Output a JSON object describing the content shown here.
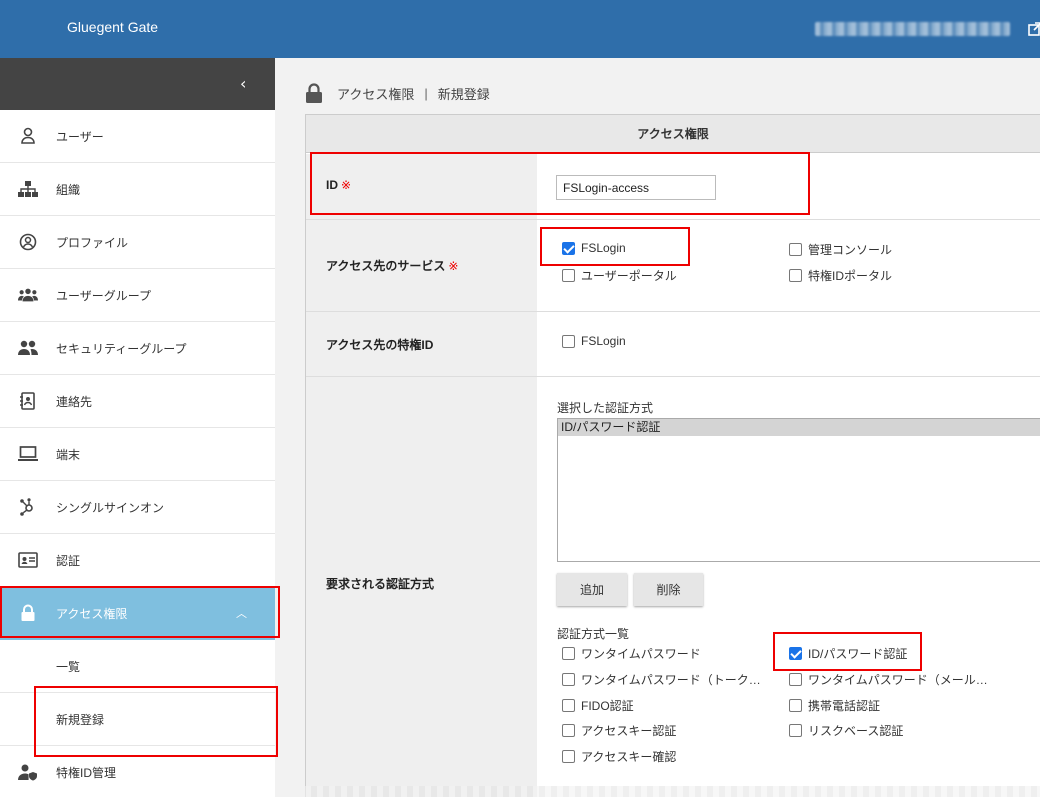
{
  "app": {
    "title": "Gluegent Gate"
  },
  "header": {
    "user_masked": ""
  },
  "sidebar": {
    "items": [
      {
        "key": "users",
        "label": "ユーザー",
        "icon": "user-icon"
      },
      {
        "key": "org",
        "label": "組織",
        "icon": "org-chart-icon"
      },
      {
        "key": "profile",
        "label": "プロファイル",
        "icon": "profile-icon"
      },
      {
        "key": "user-groups",
        "label": "ユーザーグループ",
        "icon": "group-icon"
      },
      {
        "key": "security-groups",
        "label": "セキュリティーグループ",
        "icon": "people-icon"
      },
      {
        "key": "contacts",
        "label": "連絡先",
        "icon": "contact-book-icon"
      },
      {
        "key": "devices",
        "label": "端末",
        "icon": "laptop-icon"
      },
      {
        "key": "sso",
        "label": "シングルサインオン",
        "icon": "hub-icon"
      },
      {
        "key": "auth",
        "label": "認証",
        "icon": "id-card-icon"
      },
      {
        "key": "access",
        "label": "アクセス権限",
        "icon": "lock-icon",
        "active": true
      },
      {
        "key": "access-list",
        "label": "一覧",
        "sub": true
      },
      {
        "key": "access-new",
        "label": "新規登録",
        "sub": true
      },
      {
        "key": "priv-id",
        "label": "特権ID管理",
        "icon": "user-shield-icon"
      }
    ]
  },
  "breadcrumb": {
    "section": "アクセス権限",
    "separator": "|",
    "page": "新規登録"
  },
  "form": {
    "card_title": "アクセス権限",
    "required_mark": "※",
    "id": {
      "label": "ID",
      "value": "FSLogin-access"
    },
    "services": {
      "label": "アクセス先のサービス",
      "options": [
        {
          "label": "FSLogin",
          "checked": true
        },
        {
          "label": "管理コンソール",
          "checked": false
        },
        {
          "label": "ユーザーポータル",
          "checked": false
        },
        {
          "label": "特権IDポータル",
          "checked": false
        }
      ]
    },
    "priv_ids": {
      "label": "アクセス先の特権ID",
      "options": [
        {
          "label": "FSLogin",
          "checked": false
        }
      ]
    },
    "auth_methods": {
      "label": "要求される認証方式",
      "selected_label": "選択した認証方式",
      "selected": [
        "ID/パスワード認証"
      ],
      "add_button": "追加",
      "remove_button": "削除",
      "list_label": "認証方式一覧",
      "options": [
        {
          "label": "ワンタイムパスワード",
          "checked": false
        },
        {
          "label": "ID/パスワード認証",
          "checked": true
        },
        {
          "label": "ワンタイムパスワード（トーク…",
          "checked": false
        },
        {
          "label": "ワンタイムパスワード（メール…",
          "checked": false
        },
        {
          "label": "FIDO認証",
          "checked": false
        },
        {
          "label": "携帯電話認証",
          "checked": false
        },
        {
          "label": "アクセスキー認証",
          "checked": false
        },
        {
          "label": "リスクベース認証",
          "checked": false
        },
        {
          "label": "アクセスキー確認",
          "checked": false
        }
      ]
    }
  },
  "colors": {
    "header": "#2f6eaa",
    "active_nav": "#7fbfdf",
    "highlight": "#ee0000"
  }
}
